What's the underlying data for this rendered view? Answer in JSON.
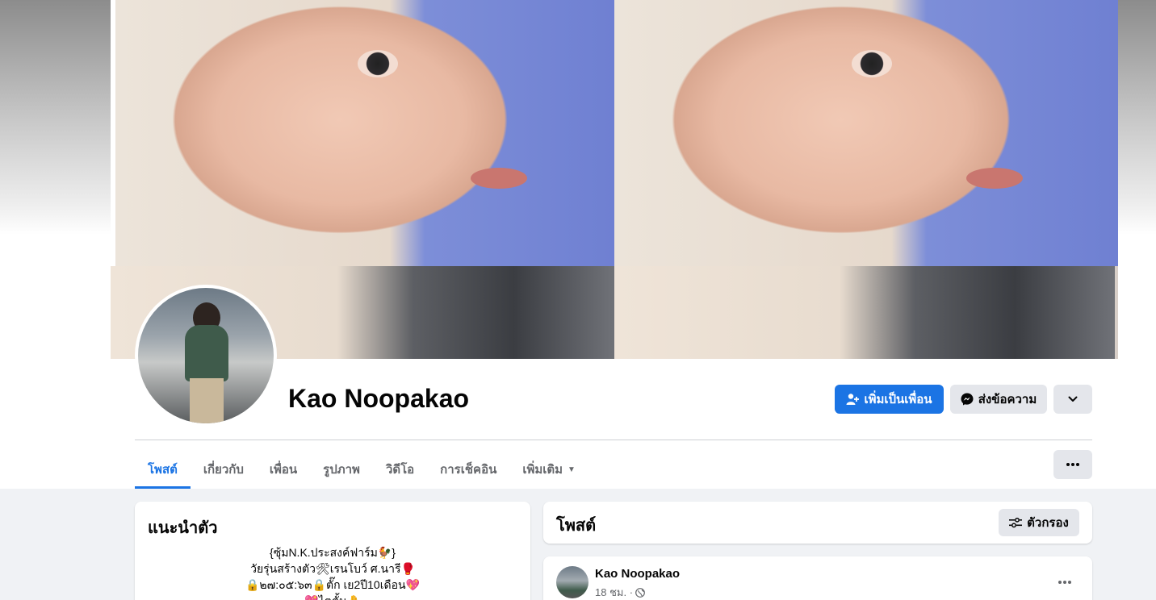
{
  "profile": {
    "name": "Kao Noopakao"
  },
  "actions": {
    "add_friend_label": "เพิ่มเป็นเพื่อน",
    "message_label": "ส่งข้อความ"
  },
  "tabs": [
    {
      "label": "โพสต์",
      "active": true
    },
    {
      "label": "เกี่ยวกับ",
      "active": false
    },
    {
      "label": "เพื่อน",
      "active": false
    },
    {
      "label": "รูปภาพ",
      "active": false
    },
    {
      "label": "วิดีโอ",
      "active": false
    },
    {
      "label": "การเช็คอิน",
      "active": false
    },
    {
      "label": "เพิ่มเติม",
      "active": false
    }
  ],
  "intro": {
    "title": "แนะนำตัว",
    "bio_lines": [
      "{ซุ้มN.K.ประสงค์ฟาร์ม🐓}",
      "วัยรุ่นสร้างตัว🛠เรนโบว์ ศ.นารี🥊",
      "🔒๒๗:๐๕:๖๓🔒ตั๊ก เย2ปี10เดือน💖",
      "💖ไตตั้ม🤚"
    ]
  },
  "posts": {
    "title": "โพสต์",
    "filter_label": "ตัวกรอง",
    "items": [
      {
        "author": "Kao Noopakao",
        "time": "18 ชม. ·"
      }
    ]
  },
  "colors": {
    "accent": "#1b74e4",
    "button_gray": "#e4e6eb",
    "background": "#f0f2f5"
  }
}
